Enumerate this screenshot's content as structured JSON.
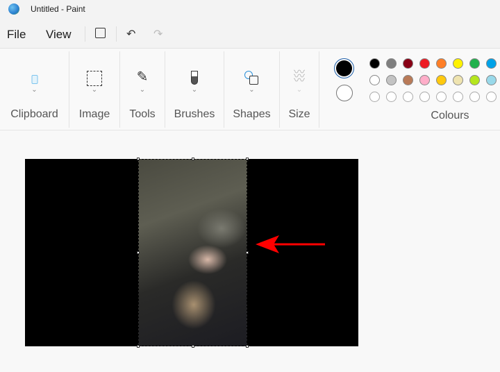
{
  "window": {
    "title": "Untitled - Paint",
    "app_icon": "paint-icon"
  },
  "menu": {
    "file": "File",
    "view": "View",
    "icons": [
      "save-icon",
      "undo-icon",
      "redo-icon"
    ]
  },
  "ribbon": {
    "groups": [
      {
        "label": "Clipboard",
        "icon": "clipboard-icon"
      },
      {
        "label": "Image",
        "icon": "select-icon"
      },
      {
        "label": "Tools",
        "icon": "tools-icon"
      },
      {
        "label": "Brushes",
        "icon": "brush-icon"
      },
      {
        "label": "Shapes",
        "icon": "shapes-icon"
      },
      {
        "label": "Size",
        "icon": "size-icon"
      }
    ],
    "colours_label": "Colours",
    "primary_colour": "#000000",
    "secondary_colour": "#ffffff",
    "palette": [
      [
        "#000000",
        "#7f7f7f",
        "#880015",
        "#ed1c24",
        "#ff7f27",
        "#fff200",
        "#22b14c",
        "#00a2e8"
      ],
      [
        "#ffffff",
        "#c3c3c3",
        "#b97a57",
        "#ffaec9",
        "#ffc90e",
        "#efe4b0",
        "#b5e61d",
        "#99d9ea"
      ],
      [
        "#ffffff",
        "#ffffff",
        "#ffffff",
        "#ffffff",
        "#ffffff",
        "#ffffff",
        "#ffffff",
        "#ffffff"
      ]
    ]
  },
  "annotation": {
    "arrow_color": "#ff0000"
  }
}
